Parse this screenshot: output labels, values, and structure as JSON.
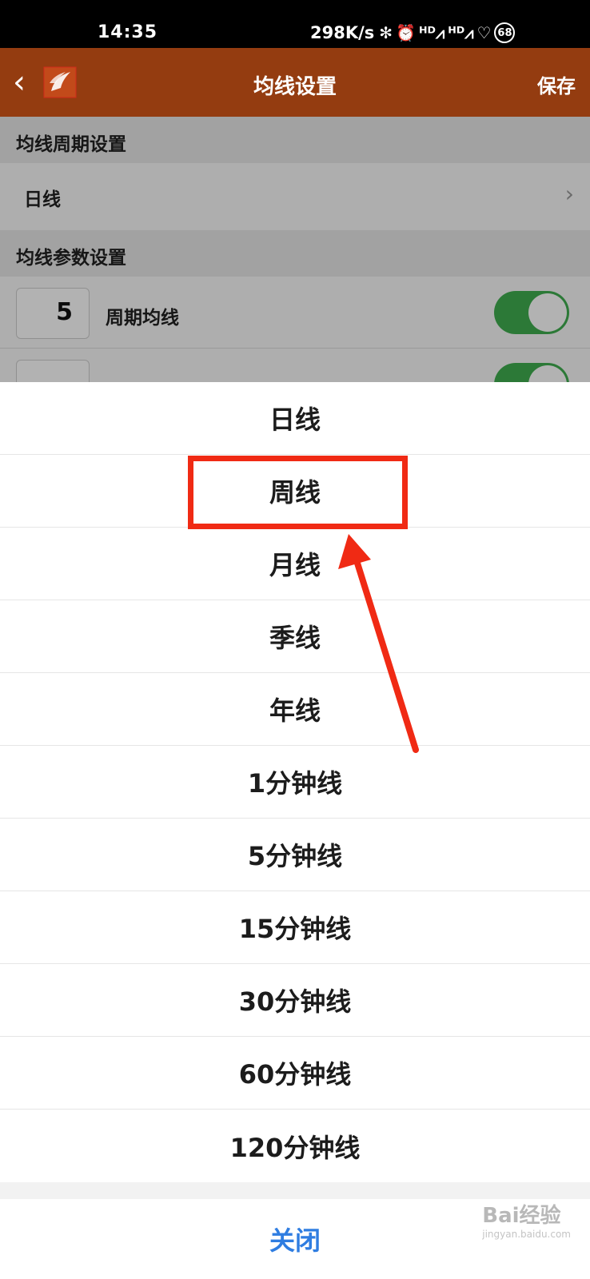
{
  "status_bar": {
    "time": "14:35",
    "speed": "298K/s",
    "battery": "68",
    "icons": [
      "bluetooth-icon",
      "alarm-icon",
      "hd-signal-icon",
      "hd-signal-icon",
      "heart-rate-icon",
      "battery-icon"
    ]
  },
  "navbar": {
    "title": "均线设置",
    "save_label": "保存",
    "back_icon": "chevron-left-icon",
    "logo_icon": "app-logo-icon",
    "background_color": "#943c10"
  },
  "sections": {
    "period_header": "均线周期设置",
    "period_value": "日线",
    "params_header": "均线参数设置",
    "param_rows": [
      {
        "value": "5",
        "label": "周期均线",
        "enabled": true
      },
      {
        "value": "",
        "label": "",
        "enabled": true
      }
    ]
  },
  "picker": {
    "options": [
      "日线",
      "周线",
      "月线",
      "季线",
      "年线",
      "1分钟线",
      "5分钟线",
      "15分钟线",
      "30分钟线",
      "60分钟线",
      "120分钟线"
    ],
    "close_label": "关闭",
    "close_color": "#2f7de1",
    "highlighted_option": "周线",
    "annotation_color": "#f02a14"
  },
  "watermark": {
    "brand": "Bai经验",
    "url": "jingyan.baidu.com"
  }
}
